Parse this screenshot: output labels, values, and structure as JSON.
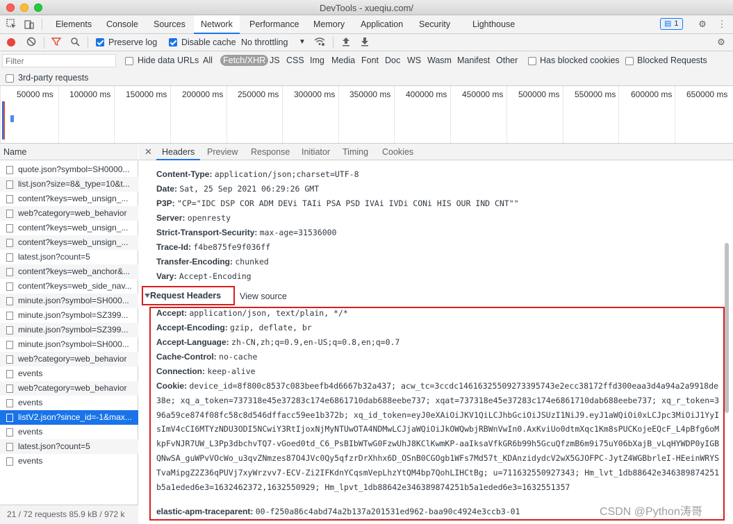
{
  "window": {
    "title": "DevTools - xueqiu.com/"
  },
  "main_tabs": [
    "Elements",
    "Console",
    "Sources",
    "Network",
    "Performance",
    "Memory",
    "Application",
    "Security",
    "Lighthouse"
  ],
  "issues_badge": "1",
  "toolbar": {
    "preserve_log": "Preserve log",
    "disable_cache": "Disable cache",
    "throttling": "No throttling"
  },
  "filter": {
    "placeholder": "Filter",
    "hide_data_urls": "Hide data URLs",
    "types": [
      "All",
      "Fetch/XHR",
      "JS",
      "CSS",
      "Img",
      "Media",
      "Font",
      "Doc",
      "WS",
      "Wasm",
      "Manifest",
      "Other"
    ],
    "selected_type": "Fetch/XHR",
    "has_blocked_cookies": "Has blocked cookies",
    "blocked_requests": "Blocked Requests",
    "third_party": "3rd-party requests"
  },
  "overview_ticks": [
    "50000 ms",
    "100000 ms",
    "150000 ms",
    "200000 ms",
    "250000 ms",
    "300000 ms",
    "350000 ms",
    "400000 ms",
    "450000 ms",
    "500000 ms",
    "550000 ms",
    "600000 ms",
    "650000 ms"
  ],
  "request_list": {
    "header": "Name",
    "rows": [
      "quote.json?symbol=SH0000...",
      "list.json?size=8&_type=10&t...",
      "content?keys=web_unsign_...",
      "web?category=web_behavior",
      "content?keys=web_unsign_...",
      "content?keys=web_unsign_...",
      "latest.json?count=5",
      "content?keys=web_anchor&...",
      "content?keys=web_side_nav...",
      "minute.json?symbol=SH000...",
      "minute.json?symbol=SZ399...",
      "minute.json?symbol=SZ399...",
      "minute.json?symbol=SH000...",
      "web?category=web_behavior",
      "events",
      "web?category=web_behavior",
      "events",
      "listV2.json?since_id=-1&max...",
      "events",
      "latest.json?count=5",
      "events"
    ],
    "selected_index": 17,
    "status": "21 / 72 requests    85.9 kB / 972 k"
  },
  "detail_tabs": [
    "Headers",
    "Preview",
    "Response",
    "Initiator",
    "Timing",
    "Cookies"
  ],
  "response_headers": [
    {
      "k": "Content-Type:",
      "v": "application/json;charset=UTF-8"
    },
    {
      "k": "Date:",
      "v": "Sat, 25 Sep 2021 06:29:26 GMT"
    },
    {
      "k": "P3P:",
      "v": "\"CP=\"IDC DSP COR ADM DEVi TAIi PSA PSD IVAi IVDi CONi HIS OUR IND CNT\"\""
    },
    {
      "k": "Server:",
      "v": "openresty"
    },
    {
      "k": "Strict-Transport-Security:",
      "v": "max-age=31536000"
    },
    {
      "k": "Trace-Id:",
      "v": "f4be875fe9f036ff"
    },
    {
      "k": "Transfer-Encoding:",
      "v": "chunked"
    },
    {
      "k": "Vary:",
      "v": "Accept-Encoding"
    }
  ],
  "request_section": {
    "title": "Request Headers",
    "view_source": "View source"
  },
  "request_headers": [
    {
      "k": "Accept:",
      "v": "application/json, text/plain, */*"
    },
    {
      "k": "Accept-Encoding:",
      "v": "gzip, deflate, br"
    },
    {
      "k": "Accept-Language:",
      "v": "zh-CN,zh;q=0.9,en-US;q=0.8,en;q=0.7"
    },
    {
      "k": "Cache-Control:",
      "v": "no-cache"
    },
    {
      "k": "Connection:",
      "v": "keep-alive"
    }
  ],
  "cookie": {
    "k": "Cookie:",
    "v": "device_id=8f800c8537c083beefb4d6667b32a437; acw_tc=3ccdc14616325509273395743e2ecc38172ffd300eaa3d4a94a2a9918de38e; xq_a_token=737318e45e37283c174e6861710dab688eebe737; xqat=737318e45e37283c174e6861710dab688eebe737; xq_r_token=396a59ce874f08fc58c8d546dffacc59ee1b372b; xq_id_token=eyJ0eXAiOiJKV1QiLCJhbGciOiJSUzI1NiJ9.eyJ1aWQiOi0xLCJpc3MiOiJ1YyIsImV4cCI6MTYzNDU3ODI5NCwiY3RtIjoxNjMyNTUwOTA4NDMwLCJjaWQiOiJkOWQwbjRBWnVwIn0.AxKviUo0dtmXqc1Km8sPUCKojeEQcF_L4pBfg6oMkpFvNJR7UW_L3Pp3dbchvTQ7-vGoed0td_C6_PsBIbWTwG0FzwUhJ8KClKwmKP-aaIksaVfkGR6b99h5GcuQfzmB6m9i75uY06bXajB_vLqHYWDP0yIGBQNwSA_guWPvVOcWo_u3qvZNmzes87O4JVc0Qy5qfzrDrXhhx6D_OSnB0CGOgb1WFs7Md57t_KDAnzidydcV2wX5GJOFPC-JytZ4WGBbrleI-HEeinWRYSTvaMipgZ2Z36qPUVj7xyWrzvv7-ECV-Zi2IFKdnYCqsmVepLhzYtQM4bp7QohLIHCtBg; u=711632550927343; Hm_lvt_1db88642e346389874251b5a1eded6e3=1632462372,1632550929; Hm_lpvt_1db88642e346389874251b5a1eded6e3=1632551357"
  },
  "elastic": {
    "k": "elastic-apm-traceparent:",
    "v": "00-f250a86c4abd74a2b137a201531ed962-baa90c4924e3ccb3-01"
  },
  "watermark": "CSDN @Python涛哥"
}
